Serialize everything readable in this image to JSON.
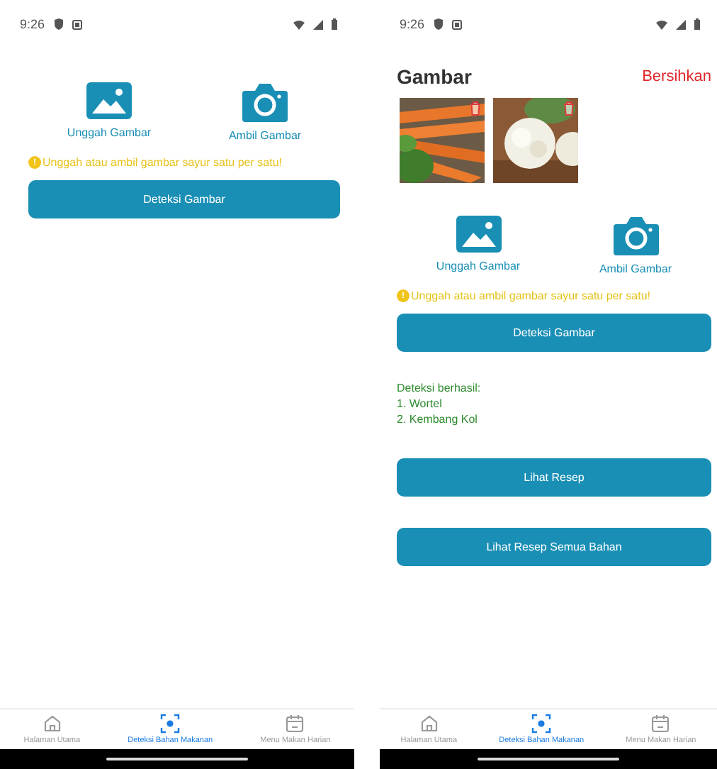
{
  "screens": [
    {
      "status_bar": {
        "time": "9:26"
      },
      "actions": [
        {
          "label": "Unggah Gambar"
        },
        {
          "label": "Ambil Gambar"
        }
      ],
      "hint": {
        "icon": "!",
        "text": "Unggah atau ambil gambar sayur satu per satu!"
      },
      "detect_button": "Deteksi Gambar",
      "nav": [
        {
          "label": "Halaman Utama",
          "selected": false
        },
        {
          "label": "Deteksi Bahan Makanan",
          "selected": true
        },
        {
          "label": "Menu Makan Harian",
          "selected": false
        }
      ]
    },
    {
      "status_bar": {
        "time": "9:26"
      },
      "gallery": {
        "title": "Gambar",
        "clear_link": "Bersihkan"
      },
      "actions": [
        {
          "label": "Unggah Gambar"
        },
        {
          "label": "Ambil Gambar"
        }
      ],
      "hint": {
        "icon": "!",
        "text": "Unggah atau ambil gambar sayur satu per satu!"
      },
      "detect_button": "Deteksi Gambar",
      "results": [
        "Deteksi berhasil:",
        "1. Wortel",
        "2. Kembang Kol"
      ],
      "buttons": [
        "Lihat Resep",
        "Lihat Resep Semua Bahan"
      ],
      "nav": [
        {
          "label": "Halaman Utama",
          "selected": false
        },
        {
          "label": "Deteksi Bahan Makanan",
          "selected": true
        },
        {
          "label": "Menu Makan Harian",
          "selected": false
        }
      ]
    }
  ]
}
